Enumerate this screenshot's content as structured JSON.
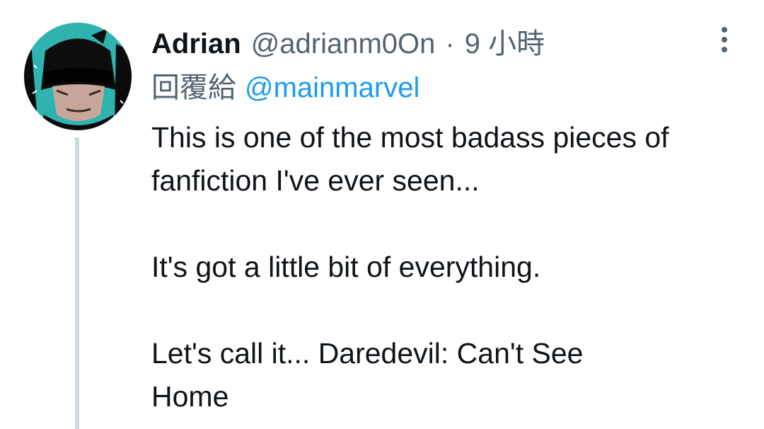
{
  "tweet": {
    "author_name": "Adrian",
    "author_handle": "@adrianm0On",
    "separator": "·",
    "time": "9 小時",
    "reply_prefix": "回覆給",
    "reply_mention": "@mainmarvel",
    "lines": [
      "This is one of the most badass pieces of",
      "fanfiction I've ever seen...",
      "It's got a little bit of everything.",
      "Let's call it... Daredevil: Can't See",
      "Home"
    ]
  },
  "icons": {
    "more": "more-vertical-icon",
    "avatar": "avatar"
  },
  "colors": {
    "text_primary": "#0f1419",
    "text_secondary": "#536471",
    "link": "#1d9bf0",
    "thread_line": "#cfd9de",
    "avatar_bg": "#2fb3b0"
  }
}
